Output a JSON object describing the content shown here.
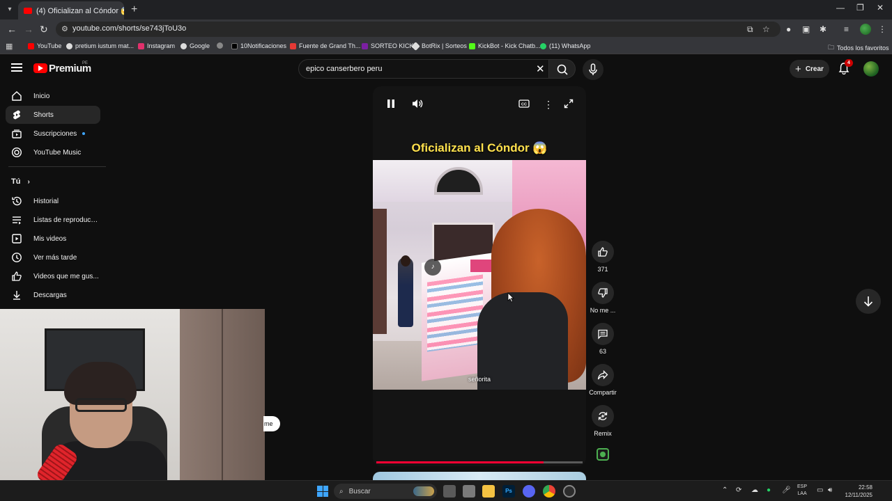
{
  "browser": {
    "tab_title": "(4) Oficializan al Cóndor 😱",
    "url": "youtube.com/shorts/se743jToU3o",
    "bookmarks": [
      {
        "label": "YouTube",
        "color": "#ff0000"
      },
      {
        "label": "pretium iustum mat...",
        "color": "#dddddd"
      },
      {
        "label": "Instagram",
        "color": "#e1306c"
      },
      {
        "label": "Google",
        "color": "#dddddd"
      },
      {
        "label": "",
        "color": "#888888"
      },
      {
        "label": "10Notificaciones",
        "color": "#000000"
      },
      {
        "label": "Fuente de Grand Th...",
        "color": "#e53935"
      },
      {
        "label": "SORTEO KICK",
        "color": "#7b1fa2"
      },
      {
        "label": "BotRix | Sorteos",
        "color": "#dddddd"
      },
      {
        "label": "KickBot - Kick Chatb...",
        "color": "#53fc18"
      },
      {
        "label": "(11) WhatsApp",
        "color": "#25d366"
      }
    ],
    "all_bookmarks_label": "Todos los favoritos"
  },
  "youtube": {
    "brand": "Premium",
    "region": "PE",
    "search_query": "epico canserbero peru",
    "create_label": "Crear",
    "notification_count": "4"
  },
  "sidebar": {
    "items": [
      {
        "label": "Inicio",
        "icon": "home-icon",
        "active": false
      },
      {
        "label": "Shorts",
        "icon": "shorts-icon",
        "active": true
      },
      {
        "label": "Suscripciones",
        "icon": "subscriptions-icon",
        "active": false
      },
      {
        "label": "YouTube Music",
        "icon": "music-icon",
        "active": false
      }
    ],
    "you_section_title": "Tú",
    "you_items": [
      {
        "label": "Historial",
        "icon": "history-icon"
      },
      {
        "label": "Listas de reproducc...",
        "icon": "playlists-icon"
      },
      {
        "label": "Mis videos",
        "icon": "my-videos-icon"
      },
      {
        "label": "Ver más tarde",
        "icon": "watch-later-icon"
      },
      {
        "label": "Videos que me gus...",
        "icon": "liked-icon"
      },
      {
        "label": "Descargas",
        "icon": "downloads-icon"
      }
    ]
  },
  "short": {
    "title": "Oficializan al Cóndor 😱",
    "caption": "señorita",
    "progress": 0.81
  },
  "actions": {
    "likes": "371",
    "dislike_label": "No me ...",
    "comments": "63",
    "share_label": "Compartir",
    "remix_label": "Remix"
  },
  "webcam": {
    "bubble_text": "me"
  },
  "taskbar": {
    "search_placeholder": "Buscar",
    "lang_top": "ESP",
    "lang_bottom": "LAA",
    "time": "22:58",
    "date": "12/11/2025"
  }
}
